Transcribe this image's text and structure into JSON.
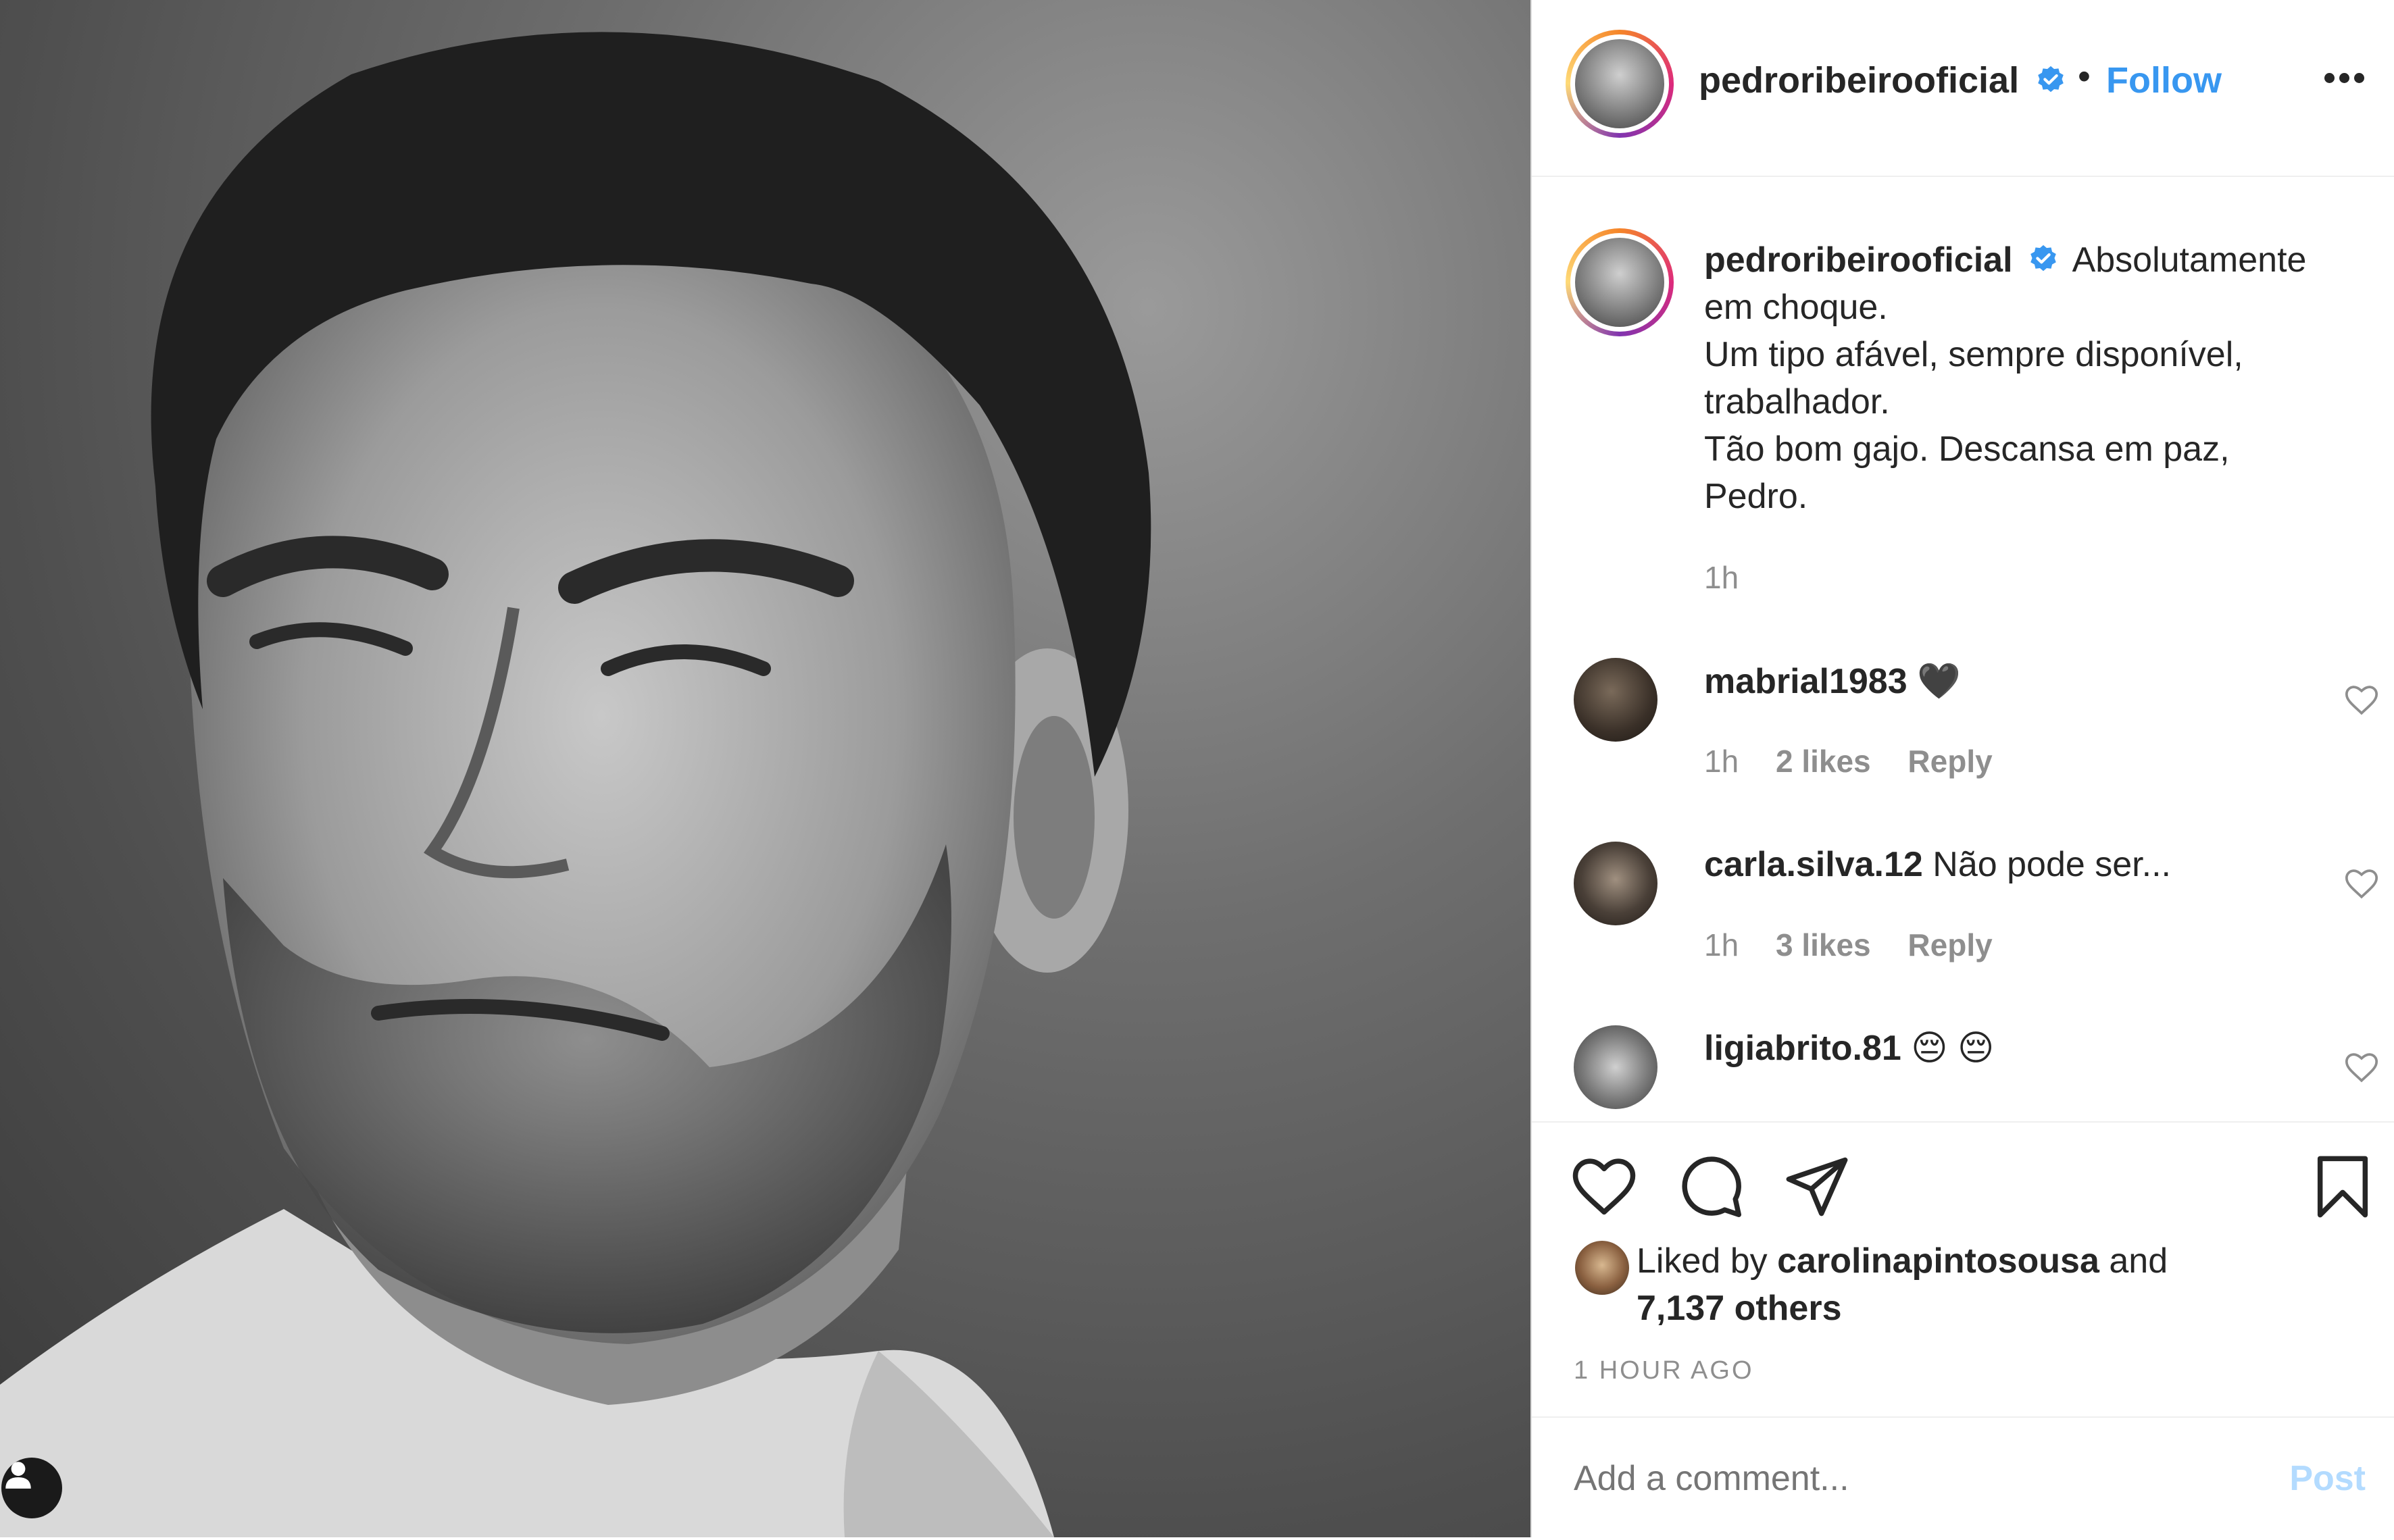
{
  "header": {
    "username": "pedroribeirooficial",
    "separator": "•",
    "follow_label": "Follow"
  },
  "caption": {
    "username": "pedroribeirooficial",
    "lines": [
      "Absolutamente",
      "em choque.",
      "Um tipo afável, sempre disponível,",
      "trabalhador.",
      "Tão bom gajo. Descansa em paz,",
      "Pedro."
    ],
    "time": "1h"
  },
  "comments": [
    {
      "username": "mabrial1983",
      "text": "🖤",
      "time": "1h",
      "likes": "2 likes",
      "reply": "Reply"
    },
    {
      "username": "carla.silva.12",
      "text": "Não pode ser...",
      "time": "1h",
      "likes": "3 likes",
      "reply": "Reply"
    },
    {
      "username": "ligiabrito.81",
      "text": "😔 😔"
    }
  ],
  "likes": {
    "prefix": "Liked by",
    "user": "carolinapintosousa",
    "and": "and",
    "others": "7,137 others"
  },
  "timestamp": "1 HOUR AGO",
  "add_comment": {
    "placeholder": "Add a comment...",
    "post_label": "Post"
  },
  "colors": {
    "accent": "#3897f0",
    "verified": "#3897f0",
    "post_disabled": "#b3dbff"
  }
}
